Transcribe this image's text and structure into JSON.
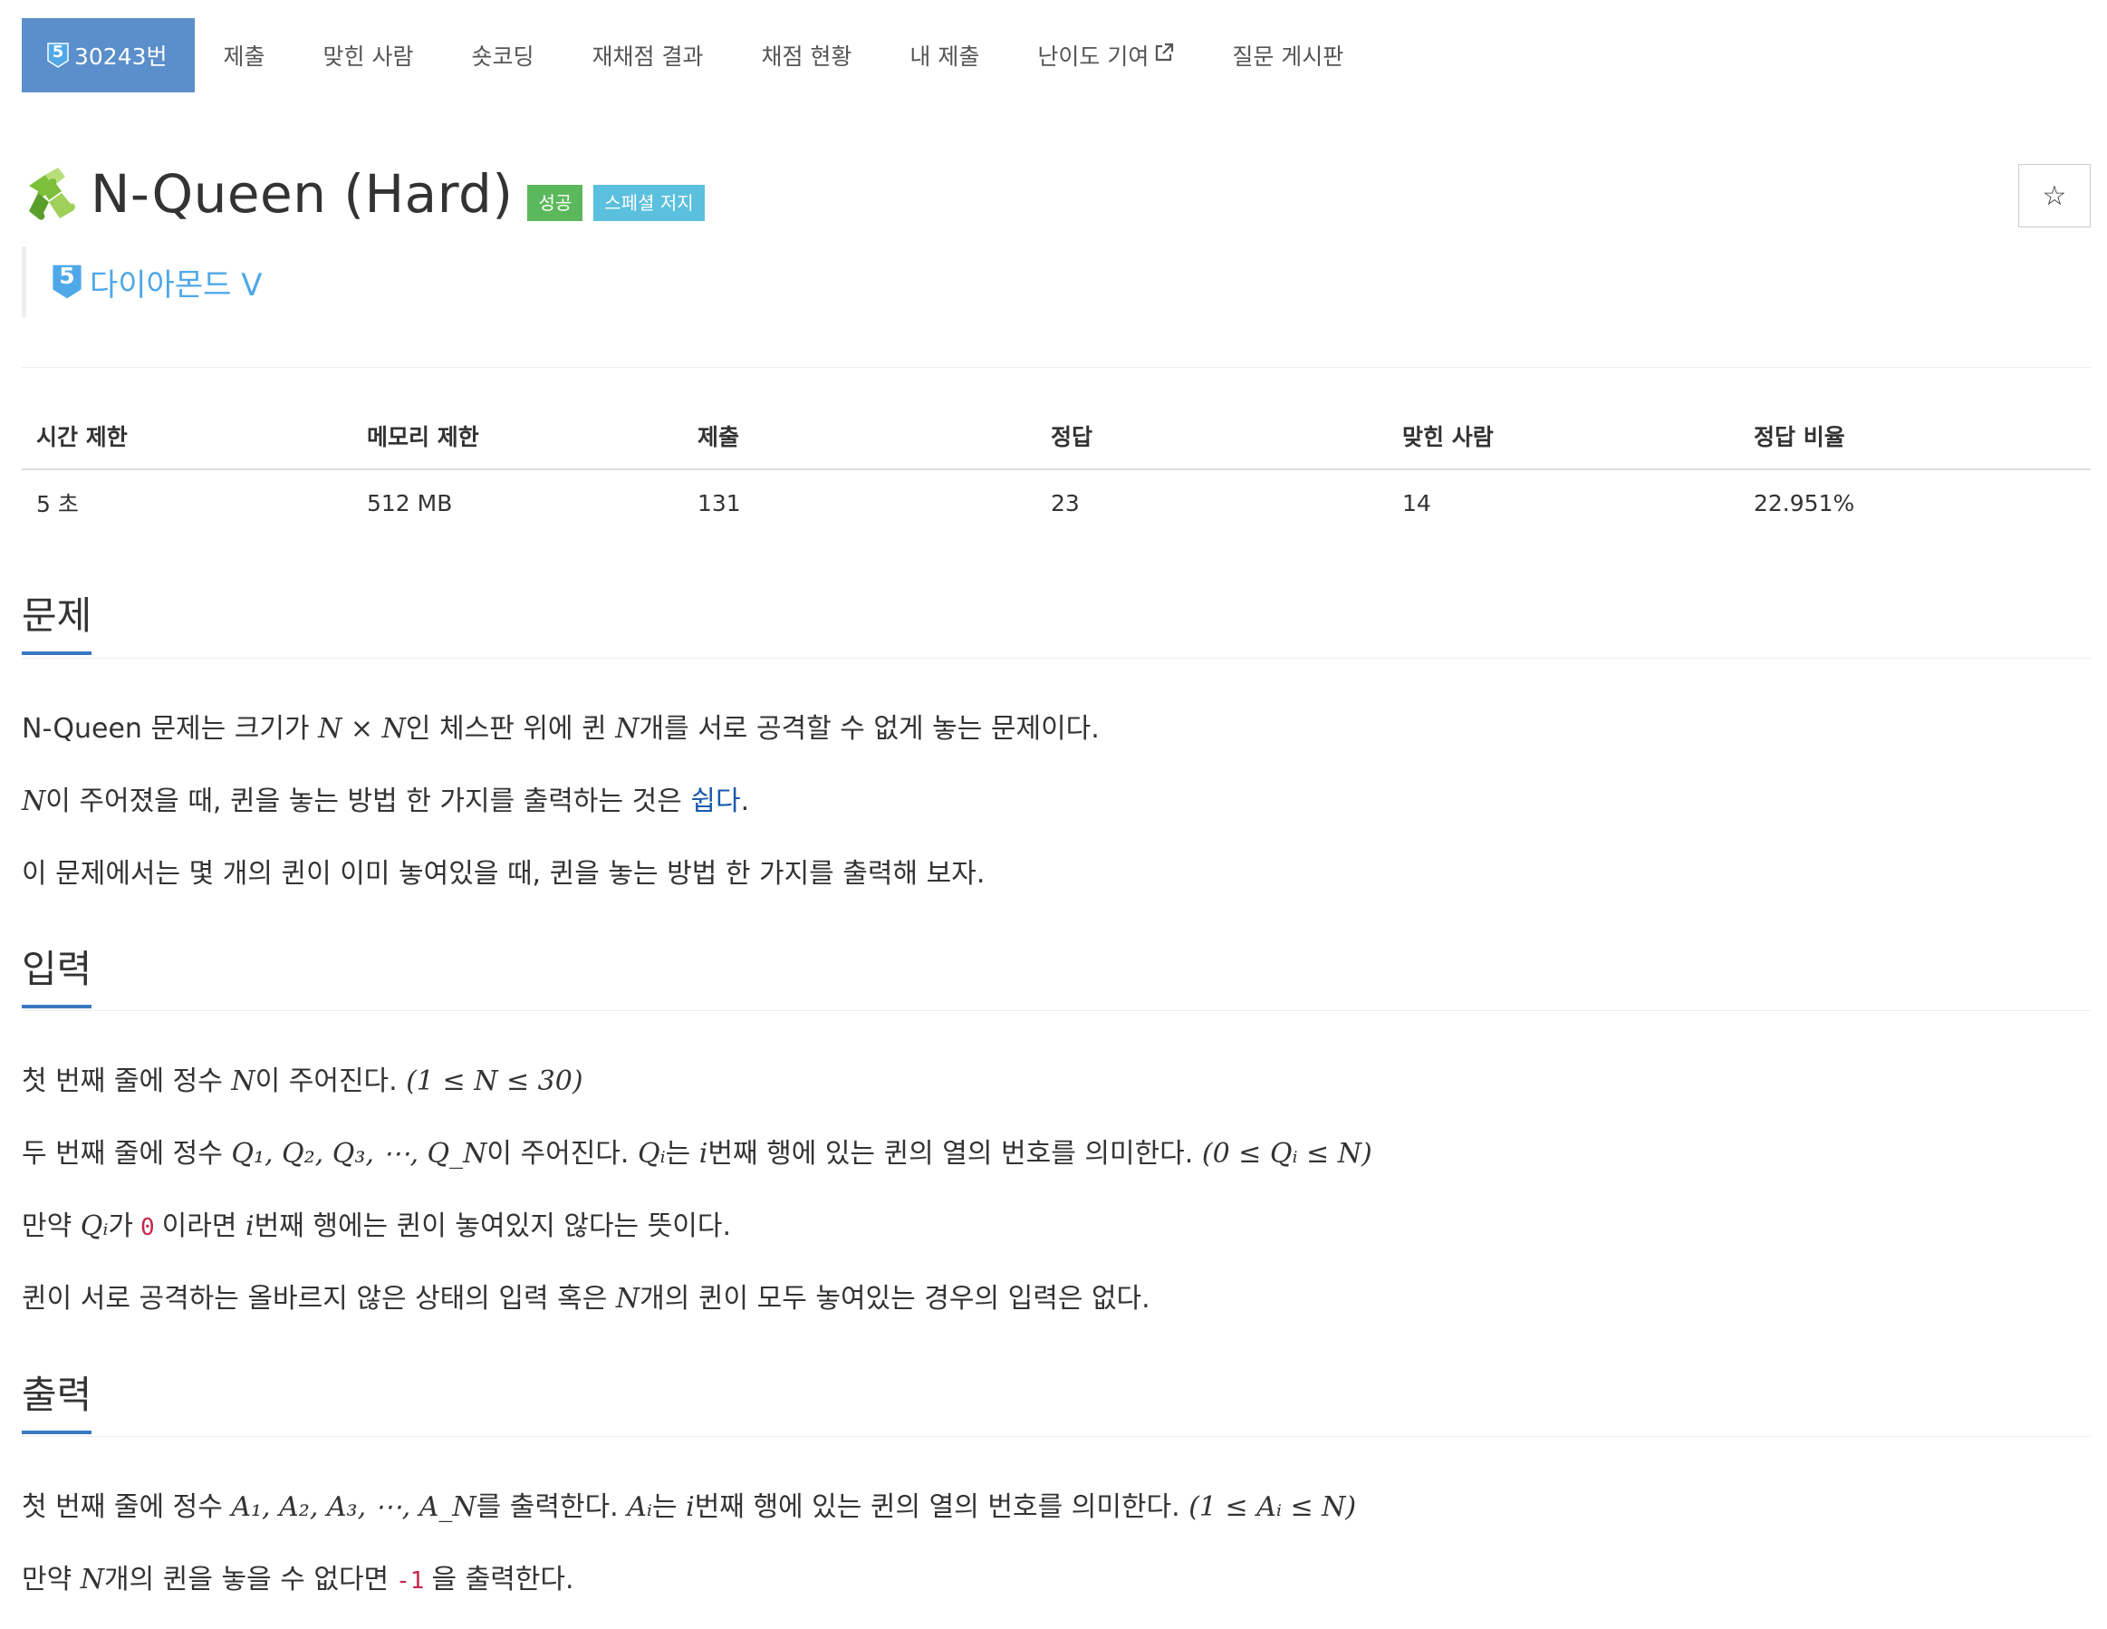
{
  "nav": {
    "problem_label": "30243번",
    "problem_tier": "5",
    "submit": "제출",
    "solved_users": "맞힌 사람",
    "short_coding": "숏코딩",
    "rejudge": "재채점 결과",
    "status": "채점 현황",
    "my_submissions": "내 제출",
    "difficulty": "난이도 기여",
    "board": "질문 게시판"
  },
  "header": {
    "title": "N-Queen (Hard)",
    "labels": [
      "성공",
      "스페셜 저지"
    ],
    "star": "☆",
    "tier_number": "5",
    "tier_name": "다이아몬드 V"
  },
  "info": {
    "headers": [
      "시간 제한",
      "메모리 제한",
      "제출",
      "정답",
      "맞힌 사람",
      "정답 비율"
    ],
    "values": [
      "5 초",
      "512 MB",
      "131",
      "23",
      "14",
      "22.951%"
    ]
  },
  "sections": {
    "problem": "문제",
    "input": "입력",
    "output": "출력"
  },
  "problem": {
    "p1": {
      "a": "N-Queen 문제는 크기가 ",
      "m1": "N × N",
      "b": "인 체스판 위에 퀸 ",
      "m2": "N",
      "c": "개를 서로 공격할 수 없게 놓는 문제이다."
    },
    "p2": {
      "m1": "N",
      "a": "이 주어졌을 때, 퀸을 놓는 방법 한 가지를 출력하는 것은 ",
      "link": "쉽다",
      "b": "."
    },
    "p3": "이 문제에서는 몇 개의 퀸이 이미 놓여있을 때, 퀸을 놓는 방법 한 가지를 출력해 보자."
  },
  "input": {
    "i1": {
      "a": "첫 번째 줄에 정수 ",
      "m1": "N",
      "b": "이 주어진다. ",
      "m2": "(1 ≤ N ≤ 30)"
    },
    "i2": {
      "a": "두 번째 줄에 정수 ",
      "m1": "Q₁, Q₂, Q₃, ⋯, Q_N",
      "b": "이 주어진다. ",
      "m2": "Qᵢ",
      "c": "는 ",
      "m3": "i",
      "d": "번째 행에 있는 퀸의 열의 번호를 의미한다. ",
      "m4": "(0 ≤ Qᵢ ≤ N)"
    },
    "i3": {
      "a": "만약 ",
      "m1": "Qᵢ",
      "b": "가",
      "code": "0",
      "c": "이라면 ",
      "m2": "i",
      "d": "번째 행에는 퀸이 놓여있지 않다는 뜻이다."
    },
    "i4": {
      "a": "퀸이 서로 공격하는 올바르지 않은 상태의 입력 혹은 ",
      "m1": "N",
      "b": "개의 퀸이 모두 놓여있는 경우의 입력은 없다."
    }
  },
  "output": {
    "o1": {
      "a": "첫 번째 줄에 정수 ",
      "m1": "A₁, A₂, A₃, ⋯, A_N",
      "b": "를 출력한다. ",
      "m2": "Aᵢ",
      "c": "는 ",
      "m3": "i",
      "d": "번째 행에 있는 퀸의 열의 번호를 의미한다. ",
      "m4": "(1 ≤ Aᵢ ≤ N)"
    },
    "o2": {
      "a": "만약 ",
      "m1": "N",
      "b": "개의 퀸을 놓을 수 없다면",
      "code": "-1",
      "c": "을 출력한다."
    }
  },
  "colors": {
    "nav_active": "#5b8fcb",
    "label_success": "#5cb85c",
    "label_special": "#5bc0de",
    "tier_diamond": "#4fa8e8",
    "heading_underline": "#3979c2",
    "link": "#1a5aa8",
    "code": "#c7254e"
  },
  "icons": [
    "tier-shield-icon",
    "puzzle-icon",
    "star-icon",
    "external-link-icon"
  ]
}
